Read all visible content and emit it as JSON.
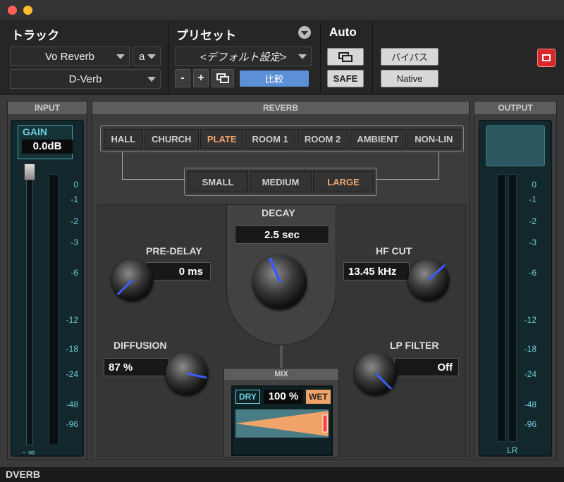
{
  "header": {
    "track_label": "トラック",
    "track_name": "Vo Reverb",
    "track_channel": "a",
    "insert_name": "D-Verb",
    "preset_label": "プリセット",
    "preset_name": "<デフォルト設定>",
    "minus_label": "-",
    "plus_label": "+",
    "compare_label": "比較",
    "auto_label": "Auto",
    "safe_label": "SAFE",
    "bypass_label": "バイパス",
    "native_label": "Native"
  },
  "input": {
    "title": "INPUT",
    "gain_label": "GAIN",
    "gain_value": "0.0dB",
    "ticks": [
      "0",
      "-1",
      "-2",
      "-3",
      "-6",
      "-12",
      "-18",
      "-24",
      "-48",
      "-96"
    ],
    "bottom_label": "- ∞"
  },
  "output": {
    "title": "OUTPUT",
    "ticks": [
      "0",
      "-1",
      "-2",
      "-3",
      "-6",
      "-12",
      "-18",
      "-24",
      "-48",
      "-96"
    ],
    "lr_label": "LR"
  },
  "reverb": {
    "title": "REVERB",
    "types": [
      "HALL",
      "CHURCH",
      "PLATE",
      "ROOM 1",
      "ROOM 2",
      "AMBIENT",
      "NON-LIN"
    ],
    "selected_type": "PLATE",
    "sizes": [
      "SMALL",
      "MEDIUM",
      "LARGE"
    ],
    "selected_size": "LARGE",
    "decay_label": "DECAY",
    "decay_value": "2.5 sec",
    "predelay_label": "PRE-DELAY",
    "predelay_value": "0 ms",
    "hfcut_label": "HF CUT",
    "hfcut_value": "13.45 kHz",
    "diffusion_label": "DIFFUSION",
    "diffusion_value": "87 %",
    "lpfilter_label": "LP FILTER",
    "lpfilter_value": "Off"
  },
  "mix": {
    "title": "MIX",
    "dry_label": "DRY",
    "value": "100 %",
    "wet_label": "WET",
    "level": 1.0
  },
  "footer": {
    "label": "DVERB"
  },
  "colors": {
    "accent_orange": "#f1a46a",
    "teal": "#6ecfdc",
    "compare_blue": "#5b8fd6",
    "knob_pointer": "#3a5cff"
  }
}
